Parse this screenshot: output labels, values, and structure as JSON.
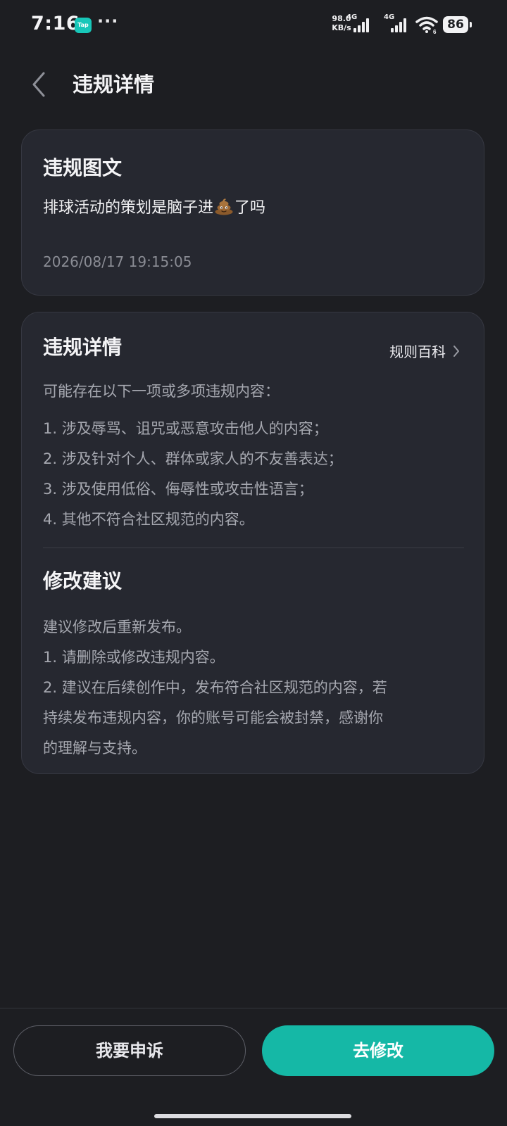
{
  "status_bar": {
    "time": "7:16",
    "tap_badge": "Tap",
    "more": "···",
    "net_speed_value": "98.0",
    "net_speed_unit": "KB/s",
    "sim1_type": "4G",
    "sim2_type": "4G",
    "battery": "86"
  },
  "header": {
    "title": "违规详情"
  },
  "content_card": {
    "title": "违规图文",
    "text_before": "排球活动的策划是脑子进",
    "emoji_icon": "poop-emoji-icon",
    "text_after": "了吗",
    "timestamp": "2026/08/17 19:15:05"
  },
  "details_card": {
    "title": "违规详情",
    "wiki_link": "规则百科",
    "intro": "可能存在以下一项或多项违规内容：",
    "rules": [
      "1. 涉及辱骂、诅咒或恶意攻击他人的内容；",
      "2. 涉及针对个人、群体或家人的不友善表达；",
      "3. 涉及使用低俗、侮辱性或攻击性语言；",
      "4. 其他不符合社区规范的内容。"
    ],
    "suggest_title": "修改建议",
    "suggestions": [
      "建议修改后重新发布。",
      "1. 请删除或修改违规内容。",
      "2. 建议在后续创作中，发布符合社区规范的内容，若",
      "持续发布违规内容，你的账号可能会被封禁，感谢你",
      "的理解与支持。"
    ]
  },
  "footer": {
    "appeal_button": "我要申诉",
    "edit_button": "去修改"
  },
  "colors": {
    "background": "#1d1e22",
    "card": "#262830",
    "accent": "#15b8a6",
    "muted_text": "#a6a8b0"
  }
}
